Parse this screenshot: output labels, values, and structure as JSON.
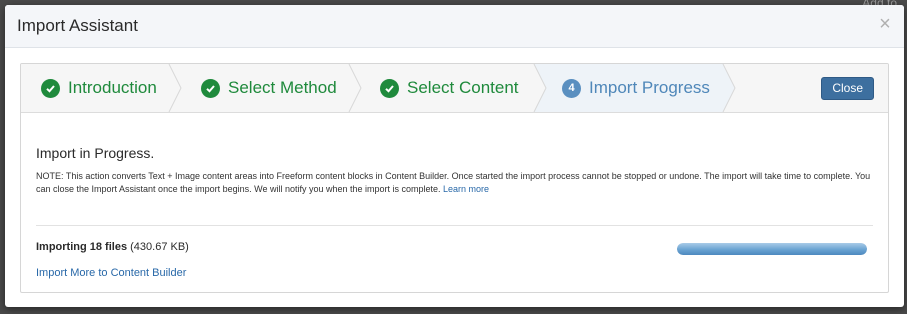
{
  "backdrop": {
    "hint_text": "Add to"
  },
  "modal": {
    "title": "Import Assistant",
    "close_glyph": "×"
  },
  "steps": [
    {
      "label": "Introduction",
      "state": "complete",
      "icon": "check-circle-icon"
    },
    {
      "label": "Select Method",
      "state": "complete",
      "icon": "check-circle-icon"
    },
    {
      "label": "Select Content",
      "state": "complete",
      "icon": "check-circle-icon"
    },
    {
      "label": "Import Progress",
      "state": "active",
      "number": "4"
    }
  ],
  "close_button_label": "Close",
  "content": {
    "heading": "Import in Progress.",
    "note": "NOTE: This action converts Text + Image content areas into Freeform content blocks in Content Builder. Once started the import process cannot be stopped or undone. The import will take time to complete. You can close the Import Assistant once the import begins. We will notify you when the import is complete. ",
    "learn_more": "Learn more"
  },
  "status": {
    "importing_label": "Importing 18 files",
    "size": "(430.67 KB)",
    "progress_fraction": 1.0
  },
  "import_more_link": "Import More to Content Builder",
  "colors": {
    "complete_step": "#1f8a3c",
    "active_step": "#4f87b9",
    "primary_button": "#3d6f9f",
    "link": "#2868a8"
  }
}
